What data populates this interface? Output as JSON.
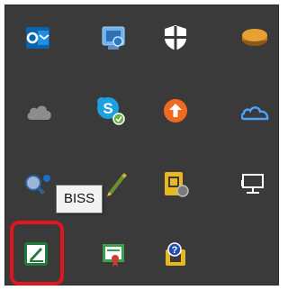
{
  "tooltip": {
    "text": "BISS"
  },
  "tray": {
    "highlight_color": "#e3141d",
    "background": "#3a3a3a",
    "icons": [
      {
        "name": "outlook-icon"
      },
      {
        "name": "network-share-icon"
      },
      {
        "name": "shield-icon"
      },
      {
        "name": "disk-cylinder-icon"
      },
      {
        "name": "cloud-icon"
      },
      {
        "name": "skype-icon"
      },
      {
        "name": "update-arrow-icon"
      },
      {
        "name": "onedrive-icon"
      },
      {
        "name": "people-search-icon"
      },
      {
        "name": "pen-tool-icon"
      },
      {
        "name": "sim-card-icon"
      },
      {
        "name": "network-monitor-icon"
      },
      {
        "name": "biss-signature-icon"
      },
      {
        "name": "certificate-icon"
      },
      {
        "name": "help-chip-icon"
      }
    ]
  }
}
